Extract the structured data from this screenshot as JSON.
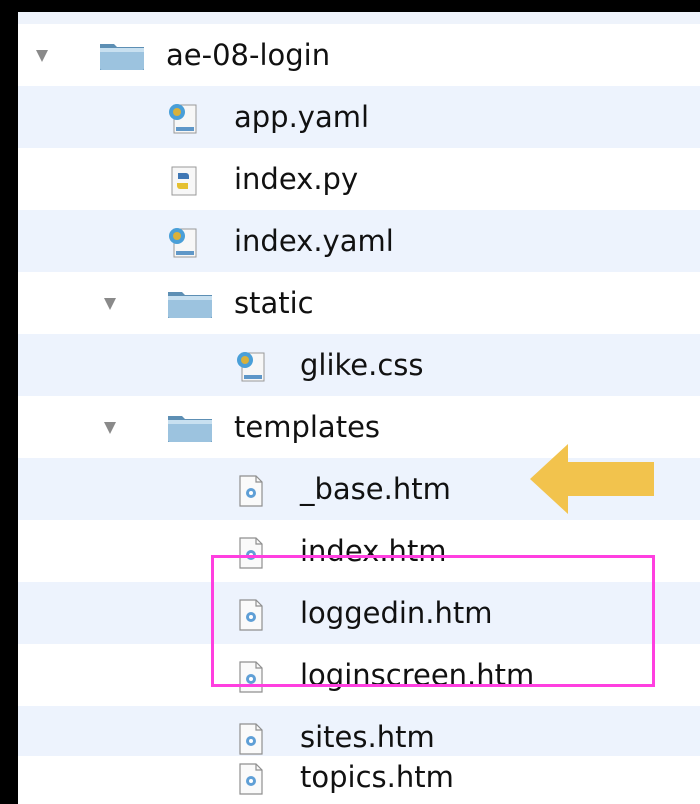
{
  "tree": {
    "items": [
      {
        "label": "ae-08-login",
        "kind": "folder",
        "expanded": true,
        "icon": "folder-icon"
      },
      {
        "label": "app.yaml",
        "kind": "file",
        "icon": "yaml-file-icon"
      },
      {
        "label": "index.py",
        "kind": "file",
        "icon": "python-file-icon"
      },
      {
        "label": "index.yaml",
        "kind": "file",
        "icon": "yaml-file-icon"
      },
      {
        "label": "static",
        "kind": "folder",
        "expanded": true,
        "icon": "folder-icon"
      },
      {
        "label": "glike.css",
        "kind": "file",
        "icon": "css-file-icon"
      },
      {
        "label": "templates",
        "kind": "folder",
        "expanded": true,
        "icon": "folder-icon"
      },
      {
        "label": "_base.htm",
        "kind": "file",
        "icon": "html-file-icon"
      },
      {
        "label": "index.htm",
        "kind": "file",
        "icon": "html-file-icon"
      },
      {
        "label": "loggedin.htm",
        "kind": "file",
        "icon": "html-file-icon"
      },
      {
        "label": "loginscreen.htm",
        "kind": "file",
        "icon": "html-file-icon"
      },
      {
        "label": "sites.htm",
        "kind": "file",
        "icon": "html-file-icon"
      },
      {
        "label": "topics.htm",
        "kind": "file",
        "icon": "html-file-icon"
      }
    ]
  },
  "annotations": {
    "arrow_color": "#f2c34d",
    "highlight_color": "#ff3fe0",
    "arrow_icon": "left-arrow-icon"
  },
  "colors": {
    "row_alt": "#edf3fd",
    "background": "#000000"
  }
}
